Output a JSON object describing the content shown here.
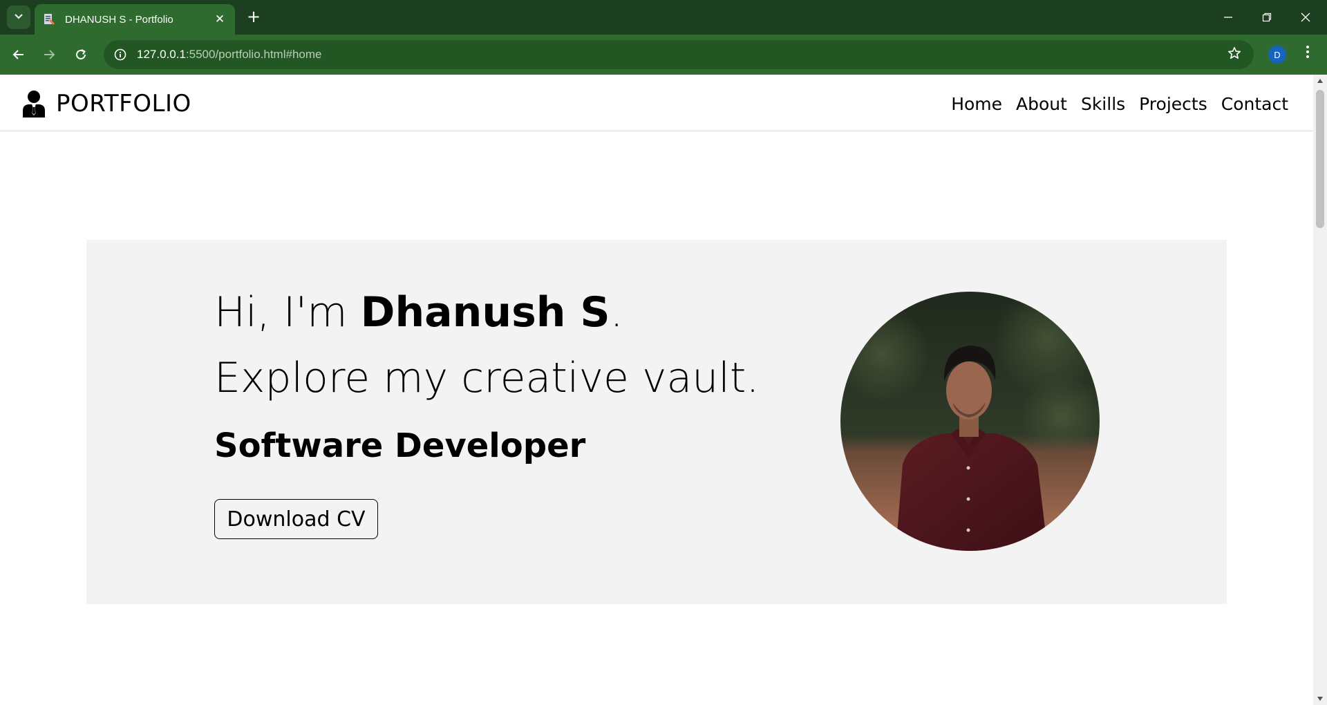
{
  "browser": {
    "tab_title": "DHANUSH S - Portfolio",
    "tab_close": "✕",
    "new_tab": "+",
    "url_host": "127.0.0.1",
    "url_rest": ":5500/portfolio.html#home",
    "profile_initial": "D",
    "window_controls": {
      "minimize": "—",
      "restore": "❐",
      "close": "✕"
    }
  },
  "header": {
    "logo_text": "PORTFOLIO",
    "nav": [
      "Home",
      "About",
      "Skills",
      "Projects",
      "Contact"
    ]
  },
  "hero": {
    "greeting_prefix": "Hi, I'm ",
    "name": "Dhanush S",
    "greeting_suffix": ".",
    "tagline": "Explore my creative vault.",
    "role": "Software Developer",
    "button_label": "Download CV"
  },
  "colors": {
    "chrome_dark": "#1c3f1f",
    "chrome_toolbar": "#2f6b2f",
    "hero_bg": "#f3f3f3",
    "text": "#000000",
    "avatar": "#1565c0"
  },
  "icons": {
    "tab_search": "chevron-down-icon",
    "favicon": "document-icon",
    "back": "arrow-left-icon",
    "forward": "arrow-right-icon",
    "reload": "reload-icon",
    "site_info": "info-icon",
    "bookmark": "star-icon",
    "menu": "kebab-menu-icon",
    "logo": "person-icon"
  }
}
